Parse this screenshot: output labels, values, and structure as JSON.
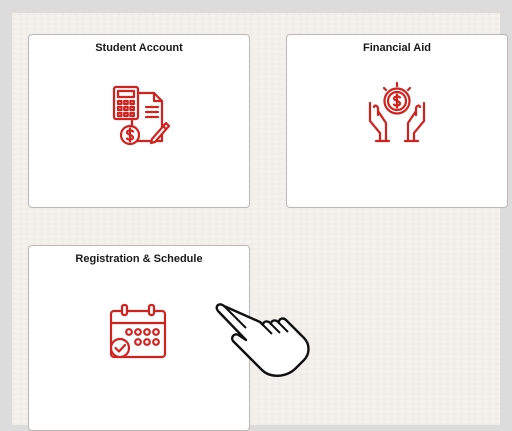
{
  "tiles": [
    {
      "title": "Student Account",
      "icon": "calculator-invoice-icon"
    },
    {
      "title": "Financial Aid",
      "icon": "hands-coin-icon"
    },
    {
      "title": "Registration & Schedule",
      "icon": "calendar-check-icon"
    }
  ],
  "colors": {
    "accent": "#d0231f",
    "page_background": "#f5f2ee",
    "tile_background": "#ffffff",
    "tile_border": "#bdb8b3"
  },
  "cursor": "hand-pointer-icon"
}
